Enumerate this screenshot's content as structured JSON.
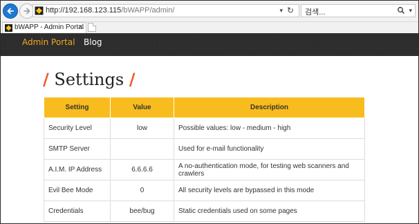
{
  "browser": {
    "url_host": "http://192.168.123.115",
    "url_path": "/bWAPP/admin/",
    "search_placeholder": "검색...",
    "tab_title": "bWAPP - Admin Portal",
    "tab_close": "×"
  },
  "nav": {
    "admin_portal": "Admin Portal",
    "blog": "Blog",
    "active_color": "#f5a623"
  },
  "page": {
    "title": "Settings",
    "title_slash": "/"
  },
  "table": {
    "headers": [
      "Setting",
      "Value",
      "Description"
    ],
    "rows": [
      {
        "setting": "Security Level",
        "value": "low",
        "description": "Possible values: low - medium - high"
      },
      {
        "setting": "SMTP Server",
        "value": "",
        "description": "Used for e-mail functionality"
      },
      {
        "setting": "A.I.M. IP Address",
        "value": "6.6.6.6",
        "description": "A no-authentication mode, for testing web scanners and crawlers"
      },
      {
        "setting": "Evil Bee Mode",
        "value": "0",
        "description": "All security levels are bypassed in this mode"
      },
      {
        "setting": "Credentials",
        "value": "bee/bug",
        "description": "Static credentials used on some pages"
      }
    ],
    "header_color": "#f9bc1e"
  },
  "icons": [
    "back-arrow-icon",
    "forward-arrow-icon",
    "site-icon",
    "dropdown-icon",
    "refresh-icon",
    "search-icon",
    "tab-favicon",
    "close-icon",
    "new-tab-icon"
  ]
}
